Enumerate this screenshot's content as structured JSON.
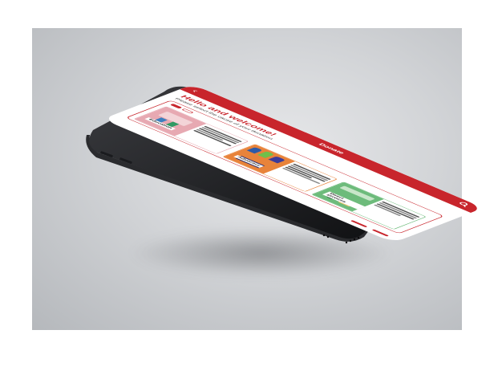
{
  "app": {
    "header_title": "Donate",
    "welcome_title": "Hello and welcome!",
    "welcome_subtitle": "Please select the cause of your donation"
  },
  "tabs": [
    {
      "label": "",
      "active": true
    },
    {
      "label": "",
      "active": false
    }
  ],
  "cards": [
    {
      "label": "Education",
      "color": "#e7a9b2"
    },
    {
      "label": "Advocacy",
      "color": "#e8833a"
    },
    {
      "label": "Direct services",
      "color": "#6dbb7b"
    }
  ],
  "buttons": {
    "back_label": "",
    "next_label": ""
  },
  "colors": {
    "brand_red": "#c8252c",
    "phone_body": "#1c1d20"
  },
  "icons": {
    "back": "chevron-left-icon",
    "search": "search-icon"
  }
}
